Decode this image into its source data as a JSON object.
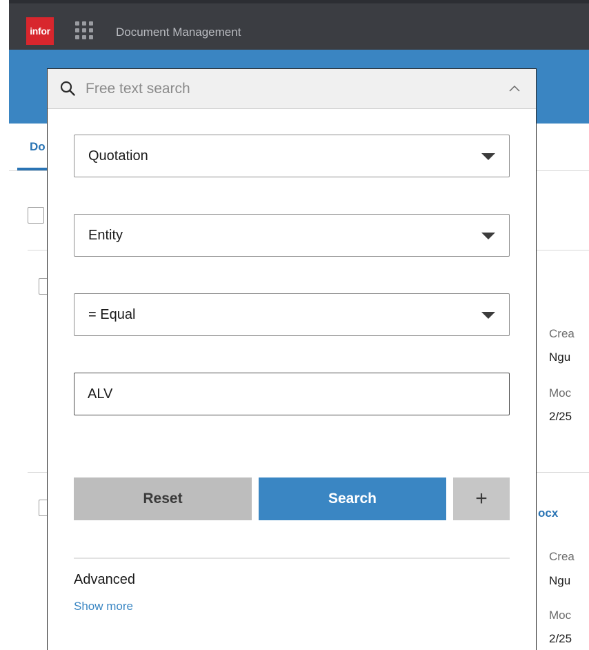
{
  "header": {
    "logo_text": "infor",
    "app_title": "Document Management",
    "brand_color": "#d8262d",
    "accent_color": "#3a85c2"
  },
  "background": {
    "tab_label": "Do",
    "card1": {
      "created_label": "Crea",
      "created_value": "Ngu",
      "modified_label": "Moc",
      "modified_value": "2/25"
    },
    "card2": {
      "file_link": "ocx",
      "created_label": "Crea",
      "created_value": "Ngu",
      "modified_label": "Moc",
      "modified_value": "2/25"
    }
  },
  "search": {
    "placeholder": "Free text search",
    "document_type": "Quotation",
    "attribute": "Entity",
    "operator": "= Equal",
    "value": "ALV",
    "reset_label": "Reset",
    "search_label": "Search",
    "add_label": "+",
    "advanced_title": "Advanced",
    "show_more_label": "Show more"
  }
}
